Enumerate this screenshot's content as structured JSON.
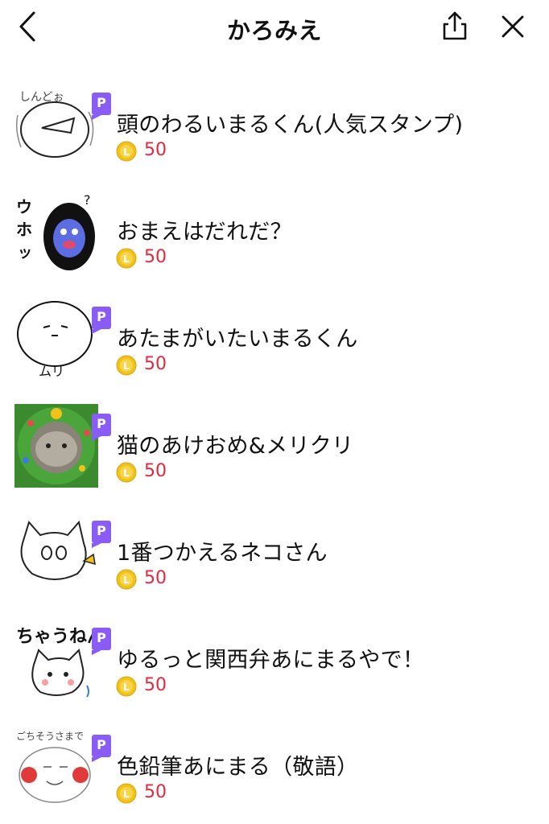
{
  "header": {
    "title": "かろみえ",
    "back_icon": "chevron-left-icon",
    "share_icon": "share-icon",
    "close_icon": "close-icon"
  },
  "colors": {
    "badge": "#8a5cf6",
    "price": "#e5283e",
    "coin": "#f2c21b"
  },
  "items": [
    {
      "name": "頭のわるいまるくん(人気スタンプ)",
      "price": "50",
      "badge": "P"
    },
    {
      "name": "おまえはだれだ？",
      "price": "50",
      "badge": ""
    },
    {
      "name": "あたまがいたいまるくん",
      "price": "50",
      "badge": "P"
    },
    {
      "name": "猫のあけおめ&メリクリ",
      "price": "50",
      "badge": "P"
    },
    {
      "name": "1番つかえるネコさん",
      "price": "50",
      "badge": "P"
    },
    {
      "name": "ゆるっと関西弁あにまるやで！",
      "price": "50",
      "badge": "P"
    },
    {
      "name": "色鉛筆あにまる（敬語）",
      "price": "50",
      "badge": "P"
    }
  ]
}
